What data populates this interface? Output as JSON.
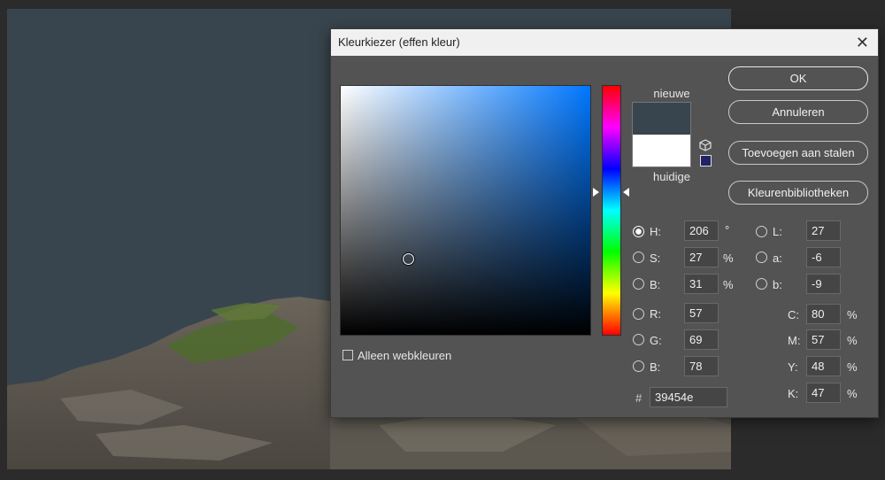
{
  "dialog": {
    "title": "Kleurkiezer (effen kleur)",
    "close_glyph": "✕"
  },
  "colors": {
    "new": "#39454e",
    "current": "#ffffff",
    "hue_base": "#0077ff"
  },
  "swatches": {
    "new_label": "nieuwe",
    "current_label": "huidige"
  },
  "icons": {
    "gamut": "cube-icon",
    "web_safe": "square-icon"
  },
  "buttons": {
    "ok": "OK",
    "cancel": "Annuleren",
    "add_swatches": "Toevoegen aan stalen",
    "libraries": "Kleurenbibliotheken"
  },
  "web_only": {
    "label": "Alleen webkleuren",
    "checked": false
  },
  "hsb": {
    "h": {
      "label": "H:",
      "value": "206",
      "unit": "°",
      "selected": true
    },
    "s": {
      "label": "S:",
      "value": "27",
      "unit": "%",
      "selected": false
    },
    "b": {
      "label": "B:",
      "value": "31",
      "unit": "%",
      "selected": false
    }
  },
  "rgb": {
    "r": {
      "label": "R:",
      "value": "57"
    },
    "g": {
      "label": "G:",
      "value": "69"
    },
    "b": {
      "label": "B:",
      "value": "78"
    }
  },
  "lab": {
    "l": {
      "label": "L:",
      "value": "27"
    },
    "a": {
      "label": "a:",
      "value": "-6"
    },
    "b": {
      "label": "b:",
      "value": "-9"
    }
  },
  "cmyk": {
    "c": {
      "label": "C:",
      "value": "80",
      "unit": "%"
    },
    "m": {
      "label": "M:",
      "value": "57",
      "unit": "%"
    },
    "y": {
      "label": "Y:",
      "value": "48",
      "unit": "%"
    },
    "k": {
      "label": "K:",
      "value": "47",
      "unit": "%"
    }
  },
  "hex": {
    "prefix": "#",
    "value": "39454e"
  }
}
